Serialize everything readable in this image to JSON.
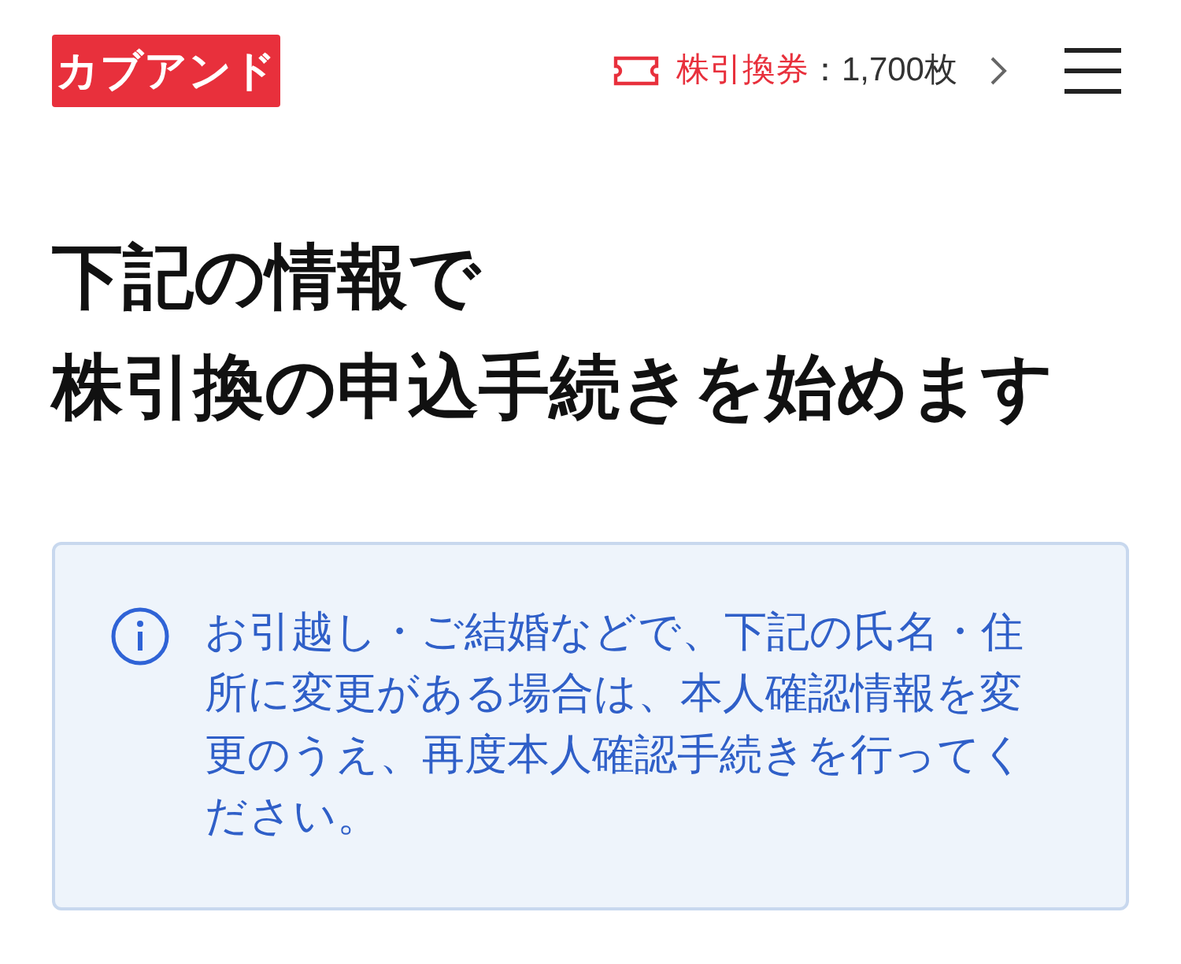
{
  "header": {
    "logo": "カブアンド",
    "ticket_label": "株引換券",
    "ticket_count": "：1,700枚"
  },
  "heading_lines": [
    "下記の情報で",
    "株引換の申込手続きを始めます"
  ],
  "notice": {
    "text": "お引越し・ご結婚などで、下記の氏名・住所に変更がある場合は、本人確認情報を変更のうえ、再度本人確認手続きを行ってください。"
  }
}
